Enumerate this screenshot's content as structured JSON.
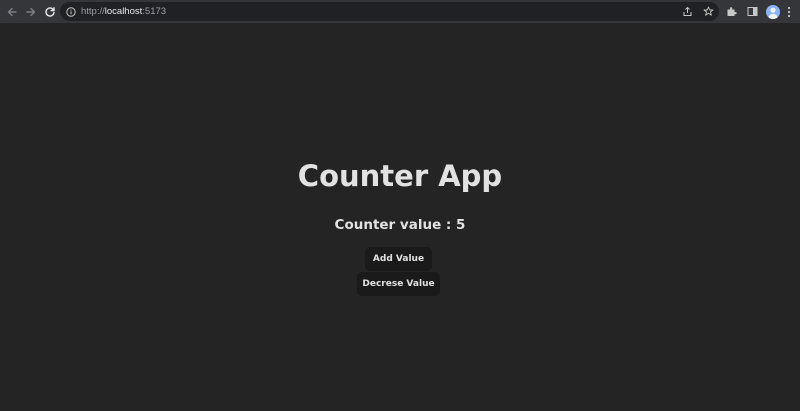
{
  "browser": {
    "url_scheme": "http://",
    "url_host": "localhost",
    "url_port": ":5173"
  },
  "app": {
    "title": "Counter App",
    "counter_label": "Counter value : ",
    "counter_value": "5",
    "add_button_label": "Add Value",
    "decrease_button_label": "Decrese Value"
  },
  "colors": {
    "page_background": "#242424",
    "button_background": "#1a1a1a",
    "chrome_background": "#35363a",
    "omnibox_background": "#202124"
  }
}
